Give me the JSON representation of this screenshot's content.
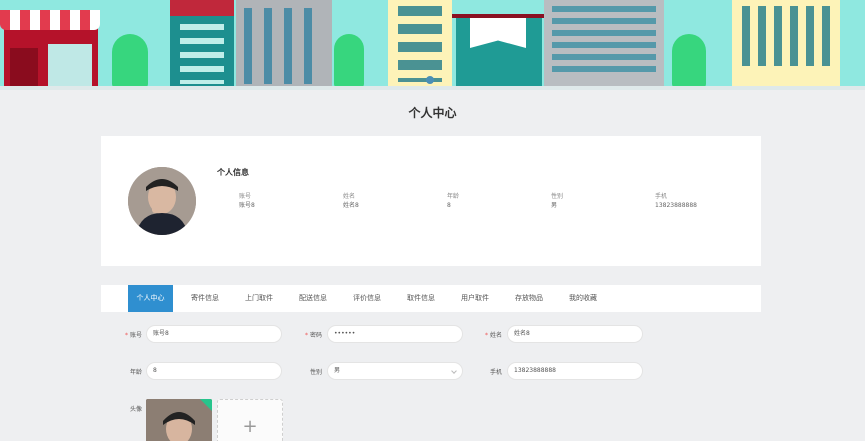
{
  "page": {
    "title": "个人中心"
  },
  "profile": {
    "section_title": "个人信息",
    "fields": [
      {
        "label": "账号",
        "value": "账号8"
      },
      {
        "label": "姓名",
        "value": "姓名8"
      },
      {
        "label": "年龄",
        "value": "8"
      },
      {
        "label": "性别",
        "value": "男"
      },
      {
        "label": "手机",
        "value": "13823888888"
      }
    ]
  },
  "tabs": [
    {
      "label": "个人中心",
      "active": true
    },
    {
      "label": "寄件信息",
      "active": false
    },
    {
      "label": "上门取件",
      "active": false
    },
    {
      "label": "配送信息",
      "active": false
    },
    {
      "label": "评价信息",
      "active": false
    },
    {
      "label": "取件信息",
      "active": false
    },
    {
      "label": "用户取件",
      "active": false
    },
    {
      "label": "存放物品",
      "active": false
    },
    {
      "label": "我的收藏",
      "active": false
    }
  ],
  "form": {
    "account": {
      "label": "账号",
      "value": "账号8",
      "required": true
    },
    "password": {
      "label": "密码",
      "value": "••••••",
      "required": true
    },
    "name": {
      "label": "姓名",
      "value": "姓名8",
      "required": true
    },
    "age": {
      "label": "年龄",
      "value": "8"
    },
    "gender": {
      "label": "性别",
      "value": "男"
    },
    "phone": {
      "label": "手机",
      "value": "13823888888"
    },
    "avatar": {
      "label": "头像",
      "upload_symbol": "+"
    }
  },
  "colors": {
    "accent": "#2f8fd0",
    "banner": "#8fe8e0",
    "required": "#e55555",
    "success": "#27c48c"
  },
  "icons": {
    "select_arrow": "chevron-down-icon",
    "upload": "plus-icon",
    "uploaded": "check-icon"
  }
}
